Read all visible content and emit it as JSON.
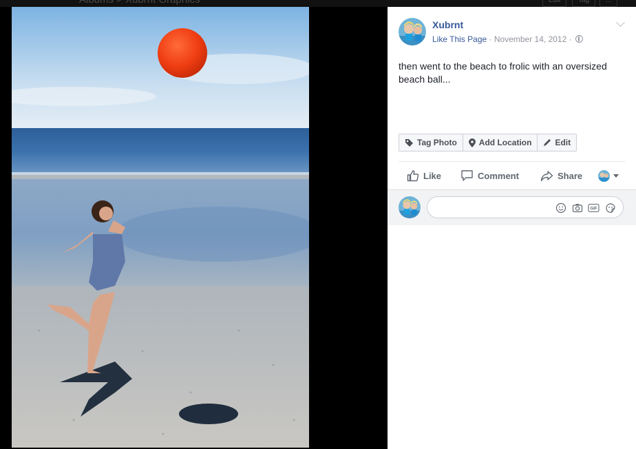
{
  "background_header": {
    "breadcrumb": "Albums  >  Xubrnt Graphics",
    "buttons": [
      "Edit",
      "Tag",
      "..."
    ]
  },
  "photo": {
    "description_icon": "beach-photo"
  },
  "post": {
    "page_name": "Xubrnt",
    "like_page": "Like This Page",
    "date": "November 14, 2012",
    "separator": "·",
    "caption": "then went to the beach to frolic with an oversized beach ball..."
  },
  "photo_actions": {
    "tag_photo": "Tag Photo",
    "add_location": "Add Location",
    "edit": "Edit"
  },
  "actions": {
    "like": "Like",
    "comment": "Comment",
    "share": "Share"
  },
  "comment": {
    "placeholder": "",
    "icons": [
      "emoji-icon",
      "camera-icon",
      "gif-icon",
      "sticker-icon"
    ],
    "gif_label": "GIF"
  },
  "colors": {
    "link": "#365899",
    "meta": "#90949c",
    "text": "#1d2129",
    "ball": "#ee3a10"
  }
}
